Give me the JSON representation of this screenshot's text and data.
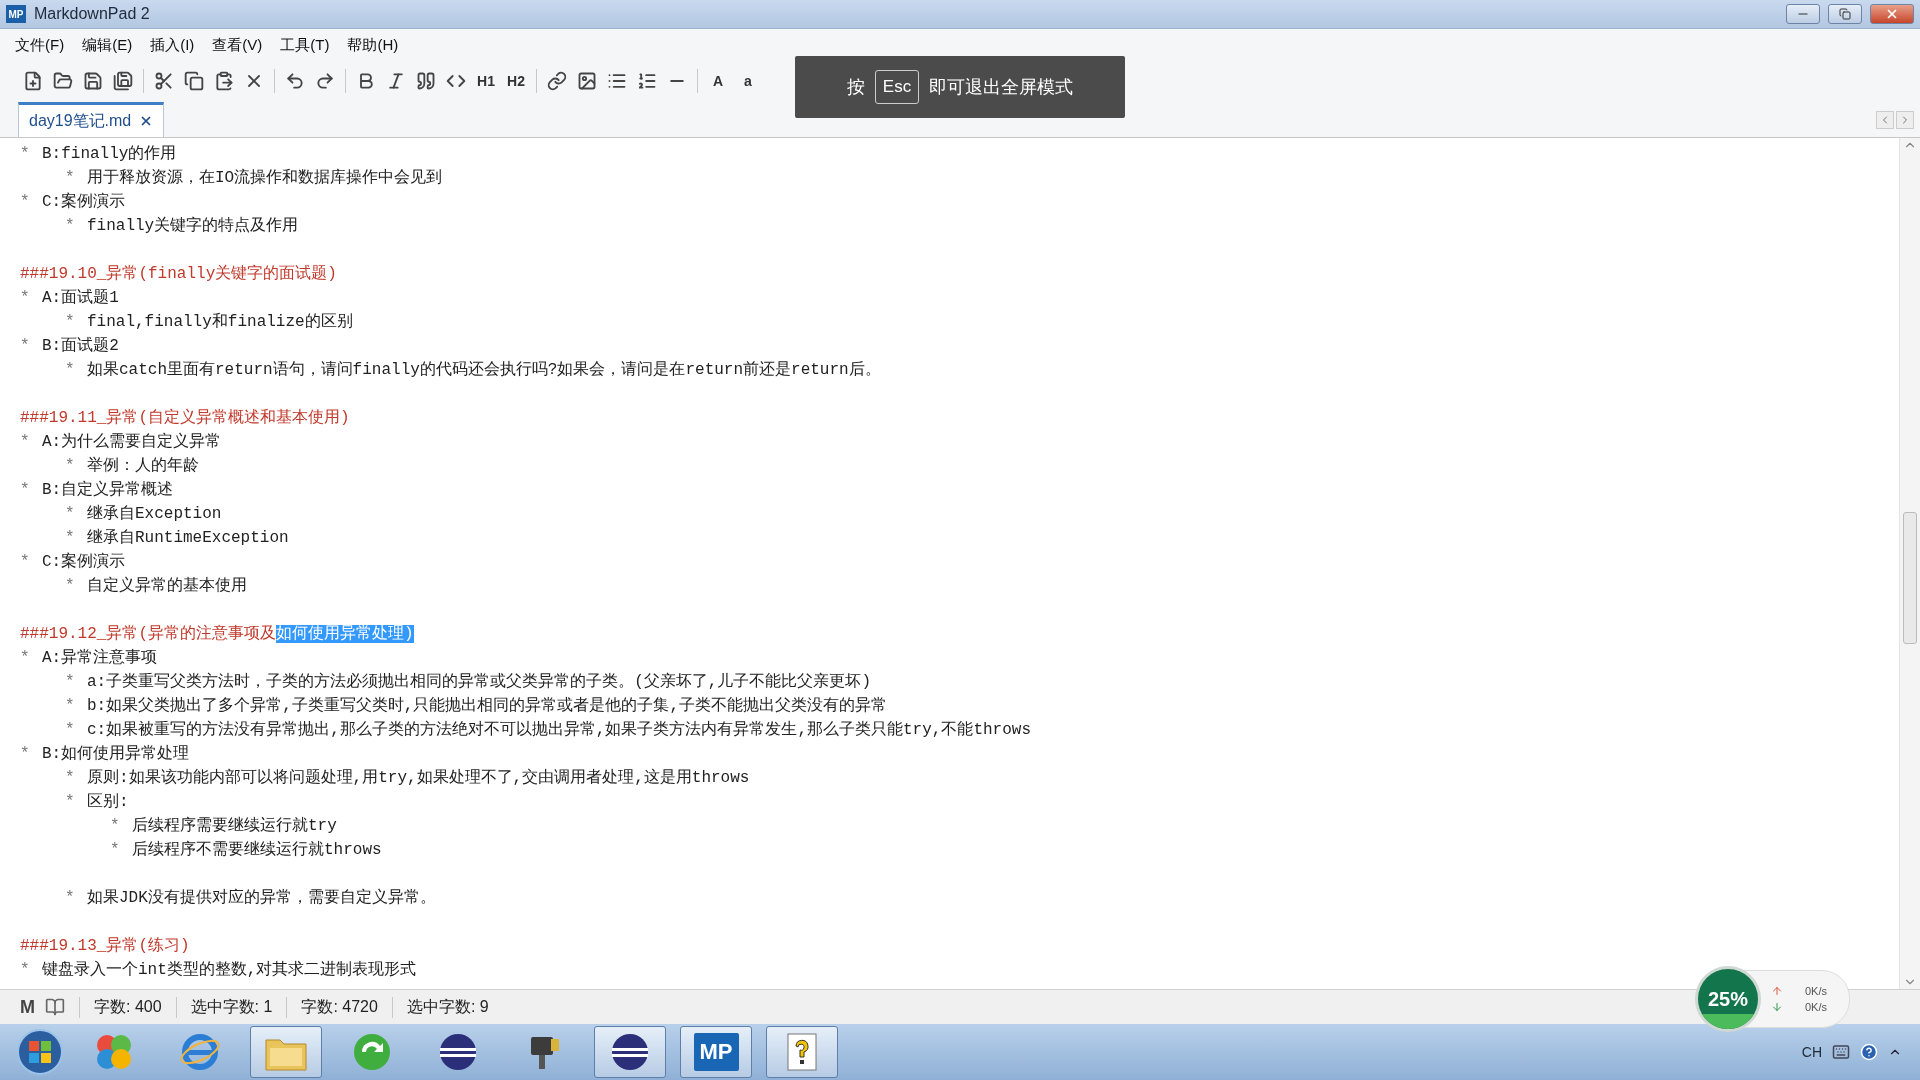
{
  "window": {
    "title": "MarkdownPad 2",
    "badge": "MP"
  },
  "menu": [
    "文件(F)",
    "编辑(E)",
    "插入(I)",
    "查看(V)",
    "工具(T)",
    "帮助(H)"
  ],
  "toolbar": {
    "headings": [
      "H1",
      "H2"
    ],
    "case": [
      "A",
      "a"
    ]
  },
  "fullscreen_notice": {
    "prefix": "按",
    "key": "Esc",
    "suffix": "即可退出全屏模式"
  },
  "tabs": [
    {
      "label": "day19笔记.md",
      "selected": true
    }
  ],
  "editor": {
    "lines": [
      {
        "kind": "bullet",
        "marker": "*",
        "text": "B:finally的作用",
        "children": [
          {
            "kind": "bullet",
            "marker": "*",
            "text": "用于释放资源，在IO流操作和数据库操作中会见到"
          }
        ]
      },
      {
        "kind": "bullet",
        "marker": "*",
        "text": "C:案例演示",
        "children": [
          {
            "kind": "bullet",
            "marker": "*",
            "text": "finally关键字的特点及作用"
          }
        ]
      },
      {
        "kind": "blank"
      },
      {
        "kind": "heading",
        "text": "###19.10_异常(finally关键字的面试题)"
      },
      {
        "kind": "bullet",
        "marker": "*",
        "text": "A:面试题1",
        "children": [
          {
            "kind": "bullet",
            "marker": "*",
            "text": "final,finally和finalize的区别"
          }
        ]
      },
      {
        "kind": "bullet",
        "marker": "*",
        "text": "B:面试题2",
        "children": [
          {
            "kind": "bullet",
            "marker": "*",
            "text": "如果catch里面有return语句，请问finally的代码还会执行吗?如果会，请问是在return前还是return后。"
          }
        ]
      },
      {
        "kind": "blank"
      },
      {
        "kind": "heading",
        "text": "###19.11_异常(自定义异常概述和基本使用)"
      },
      {
        "kind": "bullet",
        "marker": "*",
        "text": "A:为什么需要自定义异常",
        "children": [
          {
            "kind": "bullet",
            "marker": "*",
            "text": "举例：人的年龄"
          }
        ]
      },
      {
        "kind": "bullet",
        "marker": "*",
        "text": "B:自定义异常概述",
        "children": [
          {
            "kind": "bullet",
            "marker": "*",
            "text": "继承自Exception"
          },
          {
            "kind": "bullet",
            "marker": "*",
            "text": "继承自RuntimeException"
          }
        ]
      },
      {
        "kind": "bullet",
        "marker": "*",
        "text": "C:案例演示",
        "children": [
          {
            "kind": "bullet",
            "marker": "*",
            "text": "自定义异常的基本使用"
          }
        ]
      },
      {
        "kind": "blank"
      },
      {
        "kind": "heading",
        "text": "###19.12_异常(异常的注意事项及",
        "selection": "如何使用异常处理)"
      },
      {
        "kind": "bullet",
        "marker": "*",
        "text": "A:异常注意事项",
        "children": [
          {
            "kind": "bullet",
            "marker": "*",
            "text": "a:子类重写父类方法时，子类的方法必须抛出相同的异常或父类异常的子类。(父亲坏了,儿子不能比父亲更坏)"
          },
          {
            "kind": "bullet",
            "marker": "*",
            "text": "b:如果父类抛出了多个异常,子类重写父类时,只能抛出相同的异常或者是他的子集,子类不能抛出父类没有的异常"
          },
          {
            "kind": "bullet",
            "marker": "*",
            "text": "c:如果被重写的方法没有异常抛出,那么子类的方法绝对不可以抛出异常,如果子类方法内有异常发生,那么子类只能try,不能throws"
          }
        ]
      },
      {
        "kind": "bullet",
        "marker": "*",
        "text": "B:如何使用异常处理",
        "children": [
          {
            "kind": "bullet",
            "marker": "*",
            "text": "原则:如果该功能内部可以将问题处理,用try,如果处理不了,交由调用者处理,这是用throws"
          },
          {
            "kind": "bullet",
            "marker": "*",
            "text": "区别:",
            "children": [
              {
                "kind": "bullet",
                "marker": "*",
                "text": "后续程序需要继续运行就try"
              },
              {
                "kind": "bullet",
                "marker": "*",
                "text": "后续程序不需要继续运行就throws"
              }
            ]
          },
          {
            "kind": "blank"
          },
          {
            "kind": "bullet",
            "marker": "*",
            "text": "如果JDK没有提供对应的异常，需要自定义异常。"
          }
        ]
      },
      {
        "kind": "blank"
      },
      {
        "kind": "heading",
        "text": "###19.13_异常(练习)"
      },
      {
        "kind": "bullet",
        "marker": "*",
        "text": "键盘录入一个int类型的整数,对其求二进制表现形式"
      }
    ]
  },
  "status_bar_logo": "M",
  "status_bar": [
    "字数: 400",
    "选中字数: 1",
    "字数: 4720",
    "选中字数: 9"
  ],
  "speed_widget": {
    "percent": "25%",
    "upload": "0K/s",
    "download": "0K/s"
  },
  "taskbar": {
    "apps": [
      {
        "running": false
      },
      {
        "running": false
      },
      {
        "running": true
      },
      {
        "running": false
      },
      {
        "running": false
      },
      {
        "running": false
      },
      {
        "running": true
      },
      {
        "running": true,
        "label": "MP"
      },
      {
        "running": true
      }
    ],
    "tray_text": "CH"
  }
}
